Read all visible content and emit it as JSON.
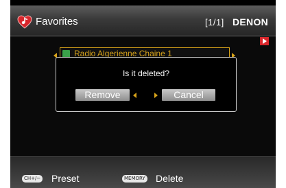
{
  "header": {
    "title": "Favorites",
    "page_counter": "[1/1]",
    "brand": "DENON"
  },
  "list": {
    "selected_item": {
      "label": "Radio Algerienne Chaine 1",
      "icon": "internet-radio-icon"
    }
  },
  "dialog": {
    "message": "Is it deleted?",
    "remove_label": "Remove",
    "cancel_label": "Cancel"
  },
  "footer": {
    "preset_key": "CH+/−",
    "preset_label": "Preset",
    "memory_key": "MEMORY",
    "delete_label": "Delete"
  },
  "colors": {
    "accent": "#d6a21a",
    "favorite": "#d8262b",
    "button": "#a8a8a8"
  }
}
